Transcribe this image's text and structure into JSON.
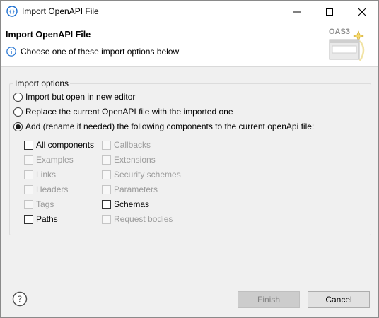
{
  "window": {
    "title": "Import OpenAPI File"
  },
  "header": {
    "title": "Import OpenAPI File",
    "message": "Choose one of these import options below",
    "banner_label": "OAS3"
  },
  "options": {
    "legend": "Import options",
    "radios": [
      {
        "label": "Import but open in new editor",
        "selected": false
      },
      {
        "label": "Replace the current OpenAPI file with the imported one",
        "selected": false
      },
      {
        "label": "Add (rename if needed) the following components to the current openApi file:",
        "selected": true
      }
    ],
    "components": {
      "left": [
        {
          "label": "All components",
          "enabled": true,
          "checked": false
        },
        {
          "label": "Examples",
          "enabled": false,
          "checked": false
        },
        {
          "label": "Links",
          "enabled": false,
          "checked": false
        },
        {
          "label": "Headers",
          "enabled": false,
          "checked": false
        },
        {
          "label": "Tags",
          "enabled": false,
          "checked": false
        },
        {
          "label": "Paths",
          "enabled": true,
          "checked": false
        }
      ],
      "right": [
        {
          "label": "Callbacks",
          "enabled": false,
          "checked": false
        },
        {
          "label": "Extensions",
          "enabled": false,
          "checked": false
        },
        {
          "label": "Security schemes",
          "enabled": false,
          "checked": false
        },
        {
          "label": "Parameters",
          "enabled": false,
          "checked": false
        },
        {
          "label": "Schemas",
          "enabled": true,
          "checked": false
        },
        {
          "label": "Request bodies",
          "enabled": false,
          "checked": false
        }
      ]
    }
  },
  "footer": {
    "finish_label": "Finish",
    "cancel_label": "Cancel",
    "finish_enabled": false
  },
  "colors": {
    "accent_blue": "#1c6fd1",
    "disabled_text": "#9b9b9b"
  }
}
